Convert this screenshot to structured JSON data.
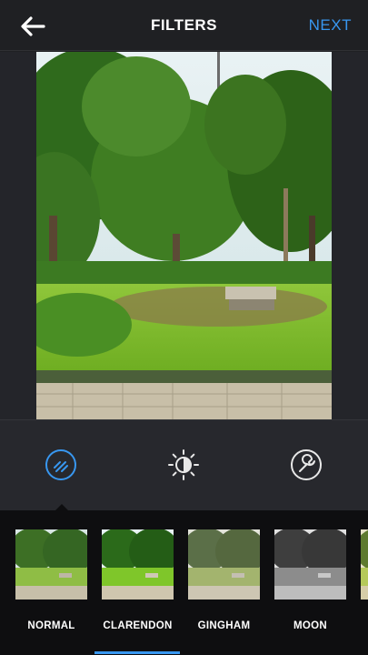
{
  "header": {
    "title": "FILTERS",
    "next_label": "NEXT",
    "back_icon": "arrow-left-icon"
  },
  "colors": {
    "accent": "#3897f0",
    "background": "#1f2023",
    "strip_background": "#0e0e10"
  },
  "tools": [
    {
      "icon": "filter-icon",
      "active": true
    },
    {
      "icon": "brightness-icon",
      "active": false
    },
    {
      "icon": "wrench-icon",
      "active": false
    }
  ],
  "filters": [
    {
      "name": "NORMAL"
    },
    {
      "name": "CLARENDON",
      "selected": true
    },
    {
      "name": "GINGHAM"
    },
    {
      "name": "MOON"
    }
  ]
}
